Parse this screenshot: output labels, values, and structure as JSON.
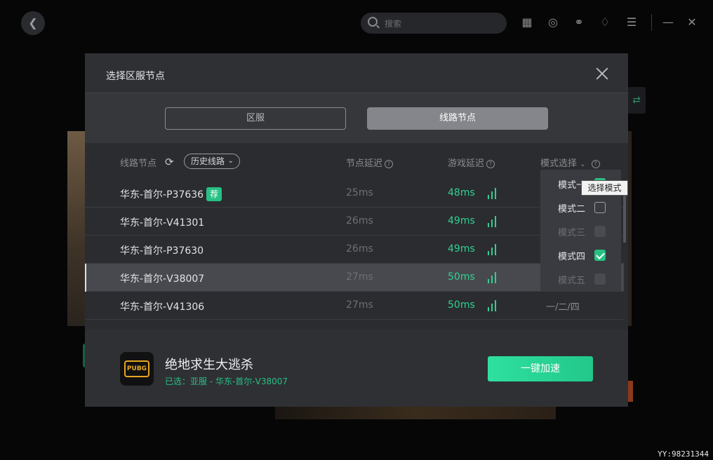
{
  "topbar": {
    "search_placeholder": "搜索",
    "icons": [
      "back-icon",
      "search-icon",
      "gift-icon",
      "target-icon",
      "headset-icon",
      "bell-icon",
      "menu-icon",
      "minimize-icon",
      "close-icon"
    ]
  },
  "modal": {
    "title": "选择区服节点",
    "tabs": [
      {
        "label": "区服",
        "active": false
      },
      {
        "label": "线路节点",
        "active": true
      }
    ],
    "columns": {
      "node": "线路节点",
      "history": "历史线路",
      "node_latency": "节点延迟",
      "game_latency": "游戏延迟",
      "mode": "模式选择"
    },
    "rows": [
      {
        "name": "华东-首尔-P37636",
        "badge": "荐",
        "node_latency": "25ms",
        "game_latency": "48ms",
        "mode": ""
      },
      {
        "name": "华东-首尔-V41301",
        "badge": "",
        "node_latency": "26ms",
        "game_latency": "49ms",
        "mode": ""
      },
      {
        "name": "华东-首尔-P37630",
        "badge": "",
        "node_latency": "26ms",
        "game_latency": "49ms",
        "mode": ""
      },
      {
        "name": "华东-首尔-V38007",
        "badge": "",
        "node_latency": "27ms",
        "game_latency": "50ms",
        "mode": "",
        "selected": true
      },
      {
        "name": "华东-首尔-V41306",
        "badge": "",
        "node_latency": "27ms",
        "game_latency": "50ms",
        "mode": "一/二/四"
      }
    ],
    "mode_dropdown": {
      "options": [
        {
          "label": "模式一",
          "state": "checked"
        },
        {
          "label": "模式二",
          "state": "unchecked"
        },
        {
          "label": "模式三",
          "state": "disabled"
        },
        {
          "label": "模式四",
          "state": "checked"
        },
        {
          "label": "模式五",
          "state": "disabled"
        }
      ],
      "tooltip": "选择模式"
    },
    "footer": {
      "game_icon_text": "PUBG",
      "game_name": "绝地求生大逃杀",
      "selected_text": "已选：亚服 - 华东-首尔-V38007",
      "accelerate_label": "一键加速"
    }
  },
  "watermark": "YY:98231344",
  "colors": {
    "accent": "#27c084",
    "modal_bg": "#2f3034",
    "latency_green": "#2fd091"
  }
}
